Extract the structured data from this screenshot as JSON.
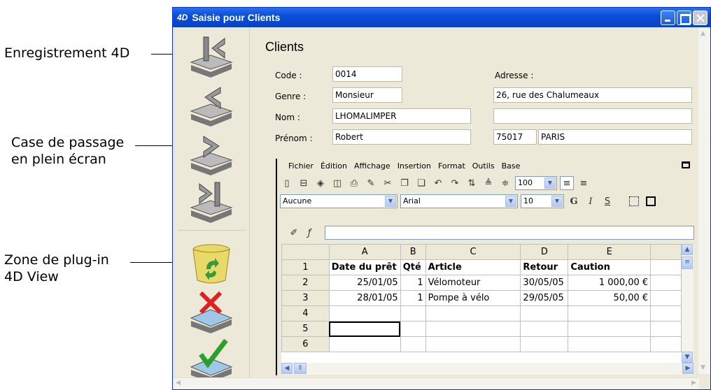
{
  "callouts": {
    "enregistrement": "Enregistrement 4D",
    "plein_ecran_line1": "Case de passage",
    "plein_ecran_line2": "en plein écran",
    "plugin_line1": "Zone de plug-in",
    "plugin_line2": "4D View"
  },
  "window": {
    "logo": "4D",
    "title": "Saisie pour  Clients"
  },
  "form": {
    "title": "Clients",
    "labels": {
      "code": "Code :",
      "genre": "Genre :",
      "nom": "Nom :",
      "prenom": "Prénom :",
      "adresse": "Adresse :"
    },
    "values": {
      "code": "0014",
      "genre": "Monsieur",
      "nom": "LHOMALIMPER",
      "prenom": "Robert",
      "adresse1": "26, rue des Chalumeaux",
      "adresse2": "",
      "cp": "75017",
      "ville": "PARIS"
    }
  },
  "plugin": {
    "menu": [
      "Fichier",
      "Édition",
      "Affichage",
      "Insertion",
      "Format",
      "Outils",
      "Base"
    ],
    "zoom": "100",
    "style_select": "Aucune",
    "font_select": "Arial",
    "size_select": "10",
    "columns": [
      "A",
      "B",
      "C",
      "D",
      "E"
    ],
    "rows": [
      {
        "n": "1",
        "cells": [
          "Date du prêt",
          "Qté",
          "Article",
          "Retour",
          "Caution"
        ]
      },
      {
        "n": "2",
        "cells": [
          "25/01/05",
          "1",
          "Vélomoteur",
          "30/05/05",
          "1 000,00 €"
        ]
      },
      {
        "n": "3",
        "cells": [
          "28/01/05",
          "1",
          "Pompe à vélo",
          "29/05/05",
          "50,00 €"
        ]
      },
      {
        "n": "4",
        "cells": [
          "",
          "",
          "",
          "",
          ""
        ]
      },
      {
        "n": "5",
        "cells": [
          "",
          "",
          "",
          "",
          ""
        ]
      },
      {
        "n": "6",
        "cells": [
          "",
          "",
          "",
          "",
          ""
        ]
      }
    ]
  },
  "icons": {
    "first": "first-record-icon",
    "prev": "previous-record-icon",
    "next": "next-record-icon",
    "last": "last-record-icon",
    "delete": "delete-record-icon",
    "cancel": "cancel-icon",
    "validate": "validate-icon"
  }
}
